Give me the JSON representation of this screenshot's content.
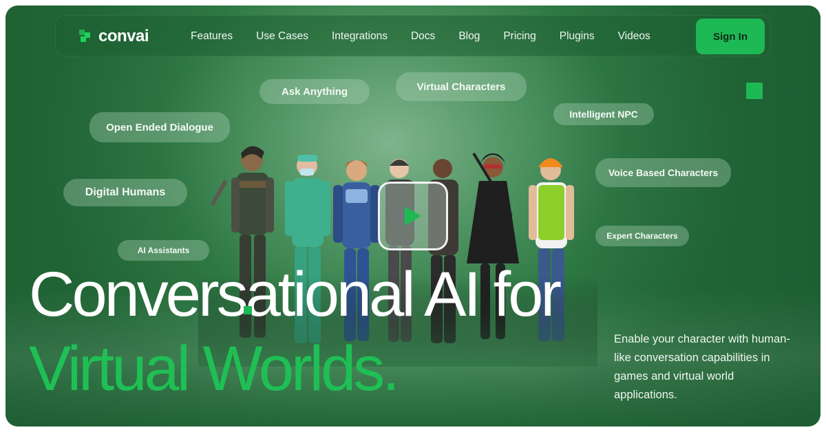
{
  "brand": {
    "name": "convai",
    "accent": "#1db954"
  },
  "nav": {
    "links": [
      "Features",
      "Use Cases",
      "Integrations",
      "Docs",
      "Blog",
      "Pricing",
      "Plugins",
      "Videos"
    ],
    "signin_label": "Sign In"
  },
  "tags": {
    "ask_anything": "Ask Anything",
    "virtual_characters": "Virtual Characters",
    "open_ended_dialogue": "Open Ended Dialogue",
    "intelligent_npc": "Intelligent NPC",
    "voice_based_characters": "Voice Based Characters",
    "digital_humans": "Digital Humans",
    "ai_assistants": "AI Assistants",
    "expert_characters": "Expert Characters"
  },
  "hero": {
    "headline_line1": "Conversational AI for",
    "headline_line2": "Virtual Worlds.",
    "description": "Enable your character with human-like conversation capabilities in games and virtual world applications."
  },
  "icons": {
    "play": "play-icon",
    "logo": "convai-logo-icon"
  }
}
